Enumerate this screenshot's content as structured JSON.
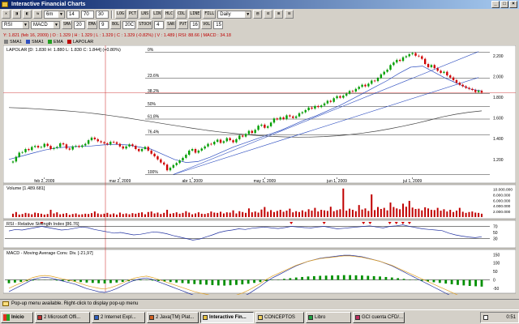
{
  "window": {
    "title": "Interactive Financial Charts"
  },
  "toolbar1": {
    "buttons": [
      "✕",
      "◨",
      "◧",
      "⇆",
      "⊞",
      "⊟"
    ],
    "period_value": "6m",
    "numbers": [
      "14",
      "70",
      "30"
    ],
    "mode_buttons": [
      "LOG",
      "PCT",
      "LNS",
      "LIN",
      "HLC",
      "CDL",
      "LINE",
      "FILL"
    ],
    "interval_value": "Daily",
    "tail_buttons": [
      "▤",
      "⊡",
      "⊞",
      "⊟"
    ]
  },
  "toolbar2": {
    "indicator_value": "RSI",
    "indicator2_value": "MACD",
    "params": [
      {
        "label": "SMA",
        "value": "20"
      },
      {
        "label": "EMA",
        "value": "9"
      },
      {
        "label": "BOL",
        "value": "20C"
      },
      {
        "label": "STOCH",
        "value": "4"
      },
      {
        "label": "SAR",
        "value": ""
      },
      {
        "label": "PVT",
        "value": "16"
      },
      {
        "label": "VOL",
        "value": "15"
      }
    ]
  },
  "info_line": "Y: 1.821 (feb 16, 2009) | O : 1.329 | H : 1.329 | L : 1.329 | C : 1.329 (-0.82%) | V : 1.489 | RSI: 88.66 | MACD : 34.18",
  "legend": [
    {
      "label": "SMA1",
      "color": "#808080"
    },
    {
      "label": "SMA1",
      "color": "#3050c0"
    },
    {
      "label": "EMA",
      "color": "#20a020"
    },
    {
      "label": "LAPOLAR",
      "color": "#c00000"
    }
  ],
  "chart_data": [
    {
      "type": "candlestick",
      "title": "LAPOLAR [D: 1.830  H: 1.880  L: 1.830  C: 1.844] (+0.80%)",
      "x_tick_labels": [
        "feb 2, 2009",
        "mar 2, 2009",
        "abr 1, 2009",
        "may 1, 2009",
        "jun 1, 2009",
        "jul 1, 2009"
      ],
      "y_tick_labels": [
        "2.200",
        "2.000",
        "1.800",
        "1.600",
        "1.400",
        "1.200"
      ],
      "ylim": [
        1050,
        2300
      ],
      "fibonacci_labels": [
        "0%",
        "23.6%",
        "38.2%",
        "50%",
        "61.8%",
        "76.4%",
        "100%"
      ],
      "fibonacci_levels": [
        2235,
        1985,
        1835,
        1712,
        1589,
        1439,
        1052
      ],
      "closes": [
        1180,
        1225,
        1265,
        1270,
        1300,
        1290,
        1320,
        1330,
        1315,
        1320,
        1350,
        1330,
        1300,
        1310,
        1320,
        1355,
        1345,
        1305,
        1295,
        1325,
        1330,
        1320,
        1335,
        1350,
        1385,
        1410,
        1395,
        1375,
        1365,
        1355,
        1345,
        1370,
        1365,
        1350,
        1325,
        1305,
        1325,
        1345,
        1330,
        1300,
        1280,
        1300,
        1320,
        1285,
        1255,
        1230,
        1200,
        1170,
        1150,
        1095,
        1120,
        1145,
        1165,
        1190,
        1215,
        1245,
        1285,
        1300,
        1265,
        1285,
        1305,
        1325,
        1350,
        1345,
        1370,
        1390,
        1360,
        1375,
        1405,
        1385,
        1365,
        1395,
        1430,
        1420,
        1445,
        1475,
        1455,
        1485,
        1525,
        1535,
        1505,
        1520,
        1555,
        1595,
        1585,
        1605,
        1590,
        1625,
        1615,
        1600,
        1615,
        1645,
        1655,
        1675,
        1700,
        1690,
        1715,
        1705,
        1720,
        1740,
        1765,
        1755,
        1790,
        1810,
        1795,
        1815,
        1835,
        1860,
        1855,
        1880,
        1900,
        1920,
        1905,
        1930,
        1960,
        1955,
        1985,
        2020,
        2045,
        2065,
        2110,
        2135,
        2160,
        2150,
        2185,
        2195,
        2215,
        2225,
        2200,
        2195,
        2170,
        2120,
        2090,
        2110,
        2080,
        2055,
        2035,
        2045,
        2010,
        1990,
        1965,
        1940,
        1920,
        1905,
        1890,
        1880,
        1870,
        1850,
        1862,
        1844
      ],
      "series": [
        {
          "name": "SMA",
          "values": [
            1700,
            1695,
            1688,
            1680,
            1672,
            1662,
            1650,
            1635,
            1618,
            1600,
            1580,
            1560,
            1540,
            1520,
            1500,
            1482,
            1466,
            1452,
            1440,
            1430,
            1422,
            1417,
            1415,
            1416,
            1420,
            1428,
            1440,
            1455,
            1473,
            1495,
            1520,
            1548,
            1578,
            1610,
            1635,
            1655,
            1668
          ]
        },
        {
          "name": "EMA",
          "values": [
            1200,
            1230,
            1260,
            1290,
            1310,
            1320,
            1325,
            1330,
            1340,
            1345,
            1340,
            1320,
            1300,
            1250,
            1200,
            1170,
            1180,
            1220,
            1270,
            1320,
            1360,
            1400,
            1440,
            1480,
            1530,
            1580,
            1620,
            1670,
            1720,
            1780,
            1840,
            1900,
            1960,
            2030,
            2090,
            2100,
            2040,
            1980,
            1930,
            1880,
            1860
          ]
        }
      ]
    },
    {
      "type": "bar",
      "title": "Volume [1.489.681]",
      "y_tick_labels": [
        "10.000.000",
        "8.000.000",
        "6.000.000",
        "4.000.000",
        "2.000.000"
      ],
      "ylim": [
        0,
        11000000
      ],
      "values": [
        1200000,
        1800000,
        900000,
        1100000,
        1500000,
        1300000,
        1000000,
        1600000,
        1400000,
        1200000,
        900000,
        1100000,
        2600000,
        1300000,
        1700000,
        1000000,
        1200000,
        1400000,
        800000,
        1100000,
        1300000,
        900000,
        1000000,
        1200000,
        1100000,
        1400000,
        2000000,
        1300000,
        1000000,
        1200000,
        1500000,
        1000000,
        1300000,
        900000,
        1600000,
        1100000,
        1300000,
        1000000,
        1400000,
        1200000,
        1500000,
        1700000,
        1000000,
        1800000,
        2000000,
        1300000,
        1600000,
        1100000,
        1500000,
        2600000,
        1200000,
        1400000,
        1700000,
        1200000,
        1500000,
        2100000,
        1600000,
        1000000,
        1300000,
        1700000,
        1200000,
        1100000,
        1400000,
        2000000,
        1600000,
        1500000,
        1900000,
        1300000,
        1700000,
        1600000,
        2400000,
        1300000,
        2100000,
        1800000,
        1500000,
        3100000,
        1700000,
        2000000,
        1600000,
        2700000,
        3600000,
        1900000,
        2500000,
        1800000,
        2200000,
        2600000,
        1900000,
        2300000,
        3000000,
        1700000,
        2100000,
        1800000,
        2400000,
        1900000,
        2800000,
        2300000,
        3300000,
        2000000,
        2600000,
        2400000,
        2200000,
        3700000,
        2100000,
        2500000,
        2800000,
        10200000,
        2300000,
        3000000,
        2600000,
        2100000,
        4300000,
        2700000,
        3100000,
        2200000,
        8100000,
        2500000,
        3600000,
        2900000,
        3300000,
        2400000,
        5200000,
        3600000,
        3100000,
        2800000,
        4800000,
        3700000,
        5800000,
        3400000,
        2900000,
        3000000,
        2400000,
        3500000,
        3100000,
        2600000,
        2500000,
        3300000,
        2300000,
        2800000,
        2000000,
        2600000,
        1800000,
        2300000,
        3300000,
        1900000,
        1500000,
        1800000,
        2000000,
        1600000,
        1500000,
        1200000
      ]
    },
    {
      "type": "line",
      "title": "RSI - Relative Strength Index [86.76]",
      "y_tick_labels": [
        "70",
        "50",
        "30"
      ],
      "ylim": [
        10,
        90
      ],
      "values": [
        55,
        60,
        58,
        62,
        66,
        70,
        66,
        62,
        58,
        60,
        64,
        68,
        66,
        60,
        56,
        52,
        48,
        50,
        46,
        42,
        44,
        48,
        52,
        50,
        46,
        40,
        35,
        30,
        25,
        28,
        35,
        42,
        50,
        55,
        58,
        62,
        60,
        64,
        66,
        68,
        65,
        63,
        66,
        70,
        68,
        66,
        65,
        68,
        70,
        66,
        62,
        64,
        66,
        68,
        70,
        72,
        68,
        65,
        70,
        72,
        75,
        70,
        66,
        62,
        60,
        58,
        56,
        48,
        42,
        38,
        35,
        33,
        36
      ]
    },
    {
      "type": "bar",
      "title": "MACD - Moving Average Conv. Div. [-21,97]",
      "y_tick_labels": [
        "150",
        "100",
        "50",
        "0",
        "-50"
      ],
      "ylim": [
        -60,
        180
      ],
      "values": [
        -20,
        -16,
        -12,
        -8,
        -4,
        -2,
        -1,
        -2,
        -4,
        -6,
        -8,
        -10,
        -13,
        -16,
        -18,
        -20,
        -21,
        -19,
        -16,
        -12,
        -8,
        -5,
        -3,
        -2,
        -4,
        -7,
        -10,
        -13,
        -16,
        -19,
        -22,
        -25,
        -27,
        -29,
        -31,
        -33,
        -34,
        -32,
        -30,
        -27,
        -23,
        -18,
        -13,
        -7,
        -2,
        2,
        6,
        10,
        14,
        17,
        20,
        22,
        24,
        25,
        26,
        27,
        28,
        28,
        27,
        26,
        24,
        22,
        20,
        17,
        14,
        10,
        6,
        2,
        -2,
        -6,
        -10,
        -14,
        -18,
        -22,
        -26,
        -30,
        -33,
        -36,
        -38,
        -40
      ]
    }
  ],
  "status_bar": {
    "message": "Pop-up menu available. Right-click to display pop-up menu"
  },
  "taskbar": {
    "start_label": "Inicio",
    "tasks": [
      {
        "label": "2 Microsoft Offi...",
        "color": "#c03030",
        "active": false
      },
      {
        "label": "2 Internet Expl...",
        "color": "#3060c0",
        "active": false
      },
      {
        "label": "2 Java(TM) Plat...",
        "color": "#d06020",
        "active": false
      },
      {
        "label": "Interactive Fin...",
        "color": "#e8c040",
        "active": true
      },
      {
        "label": "CONCEPTOS",
        "color": "#f0d060",
        "active": false
      },
      {
        "label": "Libro",
        "color": "#20a040",
        "active": false
      },
      {
        "label": "GCI cuenta CFD/...",
        "color": "#c03060",
        "active": false
      }
    ],
    "clock": "0:51"
  }
}
